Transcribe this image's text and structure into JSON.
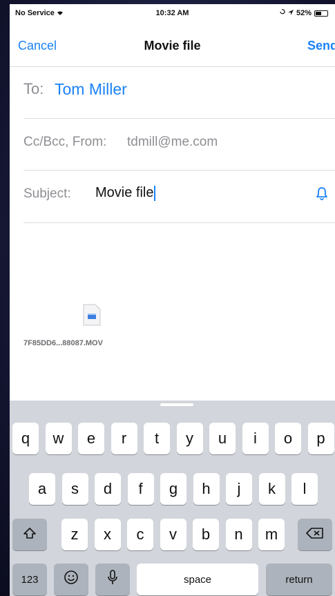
{
  "status_bar": {
    "carrier": "No Service",
    "time": "10:32 AM",
    "battery": "52%",
    "battery_level": 0.52
  },
  "nav": {
    "cancel_label": "Cancel",
    "title": "Movie file",
    "send_label": "Send"
  },
  "compose": {
    "to_label": "To:",
    "to_value": "Tom Miller",
    "cc_label": "Cc/Bcc, From:",
    "cc_value": "tdmill@me.com",
    "subject_label": "Subject:",
    "subject_value": "Movie file"
  },
  "attachment": {
    "filename": "7F85DD6...88087.MOV"
  },
  "keyboard": {
    "row1": [
      "q",
      "w",
      "e",
      "r",
      "t",
      "y",
      "u",
      "i",
      "o",
      "p"
    ],
    "row2": [
      "a",
      "s",
      "d",
      "f",
      "g",
      "h",
      "j",
      "k",
      "l"
    ],
    "row3": [
      "z",
      "x",
      "c",
      "v",
      "b",
      "n",
      "m"
    ],
    "numbers_label": "123",
    "space_label": "space",
    "return_label": "return"
  },
  "colors": {
    "accent": "#1a82f7",
    "keyboard_bg": "#d2d5db"
  }
}
